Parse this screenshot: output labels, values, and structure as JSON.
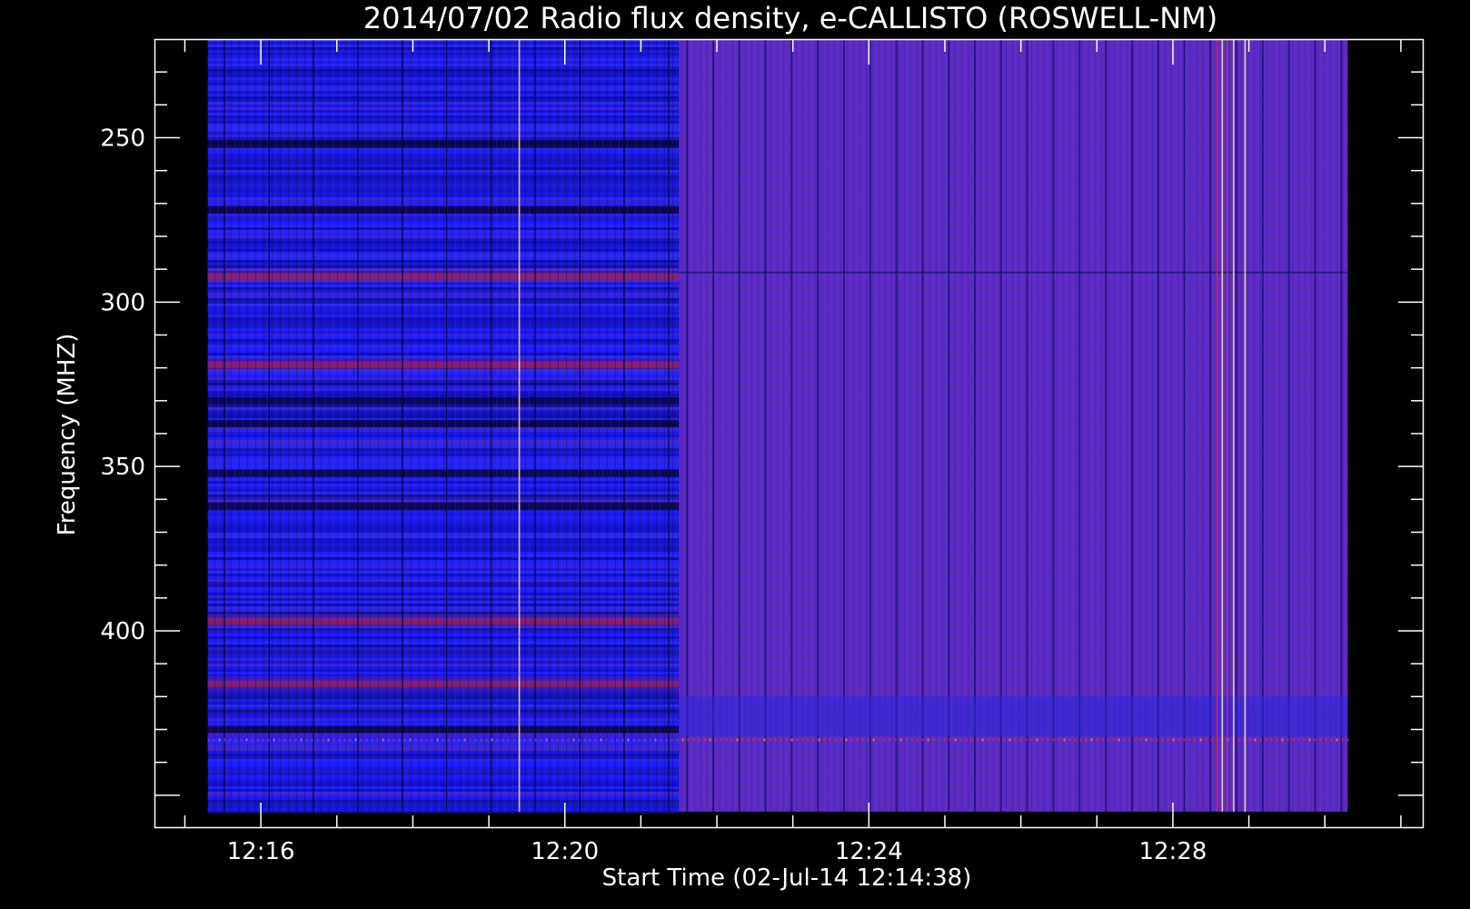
{
  "chart_data": {
    "type": "heatmap",
    "title": "2014/07/02  Radio flux density, e-CALLISTO (ROSWELL-NM)",
    "xlabel": "Start Time (02-Jul-14 12:14:38)",
    "ylabel": "Frequency (MHZ)",
    "x_tick_labels": [
      "12:16",
      "12:20",
      "12:24",
      "12:28"
    ],
    "x_tick_values_min": [
      16,
      20,
      24,
      28
    ],
    "x_range_min": [
      14.6,
      31.3
    ],
    "data_x_range_min": [
      15.3,
      30.3
    ],
    "y_tick_labels": [
      "250",
      "300",
      "350",
      "400"
    ],
    "y_tick_values": [
      250,
      300,
      350,
      400
    ],
    "y_range": [
      220,
      460
    ],
    "data_y_range": [
      220,
      455
    ],
    "y_inverted": true,
    "grid": false,
    "regimes": [
      {
        "x_min_range": [
          15.3,
          21.5
        ],
        "pattern": "horizontal-banded",
        "dominant_color": "#1c1cff"
      },
      {
        "x_min_range": [
          21.5,
          30.3
        ],
        "pattern": "uniform-vertical-streaks",
        "dominant_color": "#5a2cc4"
      }
    ],
    "bright_vertical_lines_min": [
      19.4,
      28.65,
      28.8,
      28.95
    ],
    "red_bands_mhz": [
      292,
      319,
      397,
      416
    ],
    "dark_bands_mhz": [
      252,
      272,
      330,
      337,
      352,
      362,
      430
    ],
    "interference_line_mhz": 433
  }
}
